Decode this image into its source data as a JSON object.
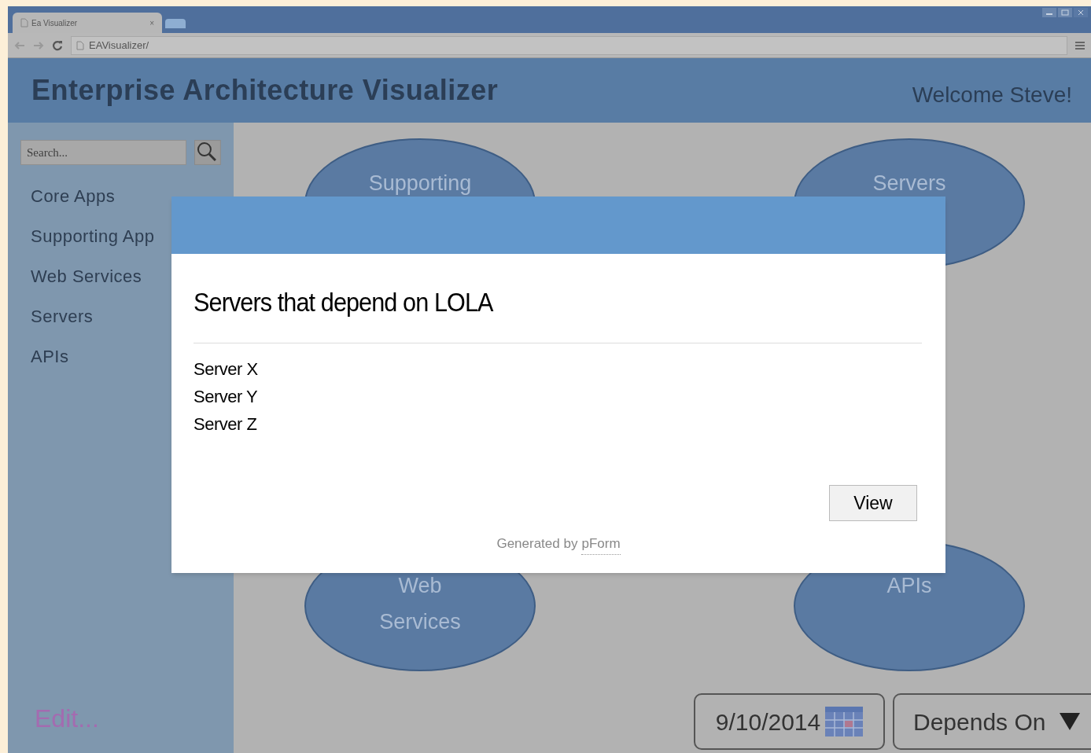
{
  "browser": {
    "tab_title": "Ea Visualizer",
    "tab_close": "×",
    "address": "EAVisualizer/"
  },
  "header": {
    "title": "Enterprise Architecture Visualizer",
    "welcome": "Welcome Steve!"
  },
  "sidebar": {
    "search_placeholder": "Search...",
    "items": [
      {
        "label": "Core Apps"
      },
      {
        "label": "Supporting App"
      },
      {
        "label": "Web Services"
      },
      {
        "label": "Servers"
      },
      {
        "label": "APIs"
      }
    ],
    "edit_link": "Edit..."
  },
  "diagram": {
    "nodes": [
      {
        "lines": [
          "Supporting"
        ]
      },
      {
        "lines": [
          "Servers"
        ]
      },
      {
        "lines": [
          "Web",
          "Services"
        ]
      },
      {
        "lines": [
          "APIs"
        ]
      }
    ]
  },
  "date_field": {
    "value": "9/10/2014"
  },
  "relation_dropdown": {
    "value": "Depends On"
  },
  "modal": {
    "title": "Servers that depend on LOLA",
    "items": [
      "Server X",
      "Server Y",
      "Server Z"
    ],
    "button": "View",
    "footer_text": "Generated by",
    "footer_link": "pForm"
  }
}
